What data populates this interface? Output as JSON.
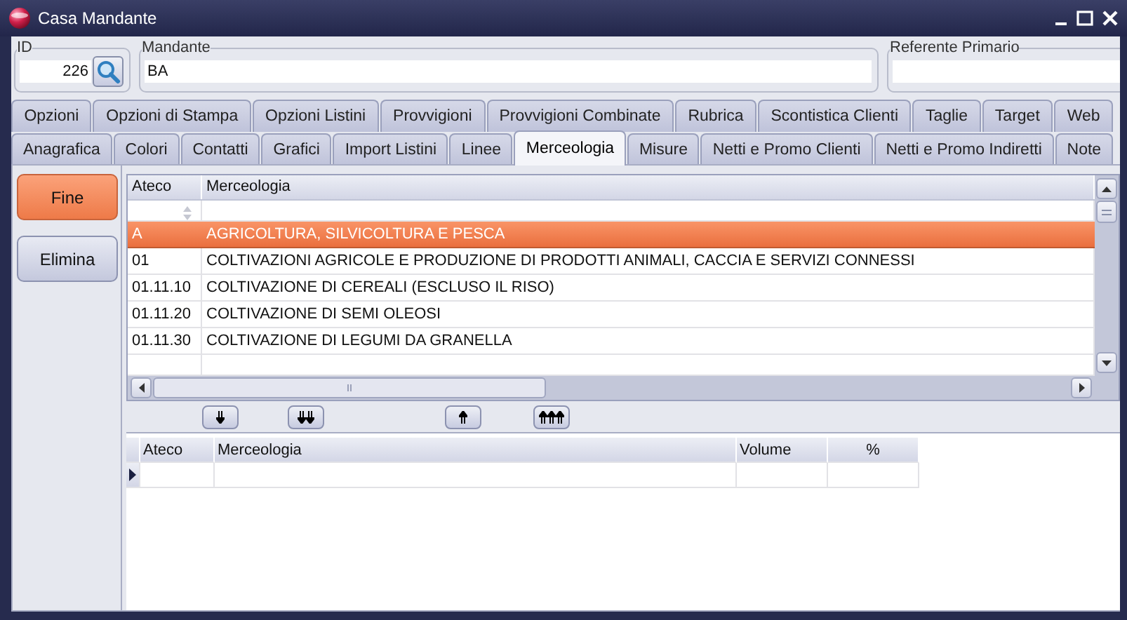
{
  "window": {
    "title": "Casa Mandante"
  },
  "fields": [
    {
      "label": "ID",
      "value": "226",
      "kind": "lookup"
    },
    {
      "label": "Mandante",
      "value": "BA",
      "kind": "text"
    },
    {
      "label": "Referente Primario",
      "kind": "text"
    }
  ],
  "tab_rows": [
    {
      "tabs": [
        {
          "label": "Opzioni",
          "selected": false
        },
        {
          "label": "Opzioni di Stampa",
          "selected": false
        },
        {
          "label": "Opzioni Listini",
          "selected": false
        },
        {
          "label": "Provvigioni",
          "selected": false
        },
        {
          "label": "Provvigioni Combinate",
          "selected": false
        },
        {
          "label": "Rubrica",
          "selected": false
        },
        {
          "label": "Scontistica Clienti",
          "selected": false
        },
        {
          "label": "Taglie",
          "selected": false
        },
        {
          "label": "Target",
          "selected": false
        },
        {
          "label": "Web",
          "selected": false
        }
      ]
    },
    {
      "tabs": [
        {
          "label": "Anagrafica",
          "selected": false
        },
        {
          "label": "Colori",
          "selected": false
        },
        {
          "label": "Contatti",
          "selected": false
        },
        {
          "label": "Grafici",
          "selected": false
        },
        {
          "label": "Import Listini",
          "selected": false
        },
        {
          "label": "Linee",
          "selected": false
        },
        {
          "label": "Merceologia",
          "selected": true
        },
        {
          "label": "Misure",
          "selected": false
        },
        {
          "label": "Netti e Promo Clienti",
          "selected": false
        },
        {
          "label": "Netti e Promo Indiretti",
          "selected": false
        },
        {
          "label": "Note",
          "selected": false
        }
      ]
    }
  ],
  "buttons": [
    {
      "label": "Fine",
      "highlighted": true
    },
    {
      "label": "Elimina",
      "highlighted": false
    }
  ],
  "upper_table": {
    "columns": [
      "Ateco",
      "Merceologia"
    ],
    "rows": [
      {
        "cells": [
          "A",
          "AGRICOLTURA, SILVICOLTURA E PESCA"
        ],
        "selected": true
      },
      {
        "cells": [
          "01",
          "COLTIVAZIONI AGRICOLE E PRODUZIONE DI PRODOTTI ANIMALI, CACCIA E SERVIZI CONNESSI"
        ],
        "selected": false
      },
      {
        "cells": [
          "01.11.10",
          "COLTIVAZIONE DI CEREALI (ESCLUSO IL RISO)"
        ],
        "selected": false
      },
      {
        "cells": [
          "01.11.20",
          "COLTIVAZIONE DI SEMI OLEOSI"
        ],
        "selected": false
      },
      {
        "cells": [
          "01.11.30",
          "COLTIVAZIONE DI LEGUMI DA GRANELLA"
        ],
        "selected": false
      }
    ]
  },
  "lower_table": {
    "columns": [
      "Ateco",
      "Merceologia",
      "Volume",
      "%"
    ]
  }
}
